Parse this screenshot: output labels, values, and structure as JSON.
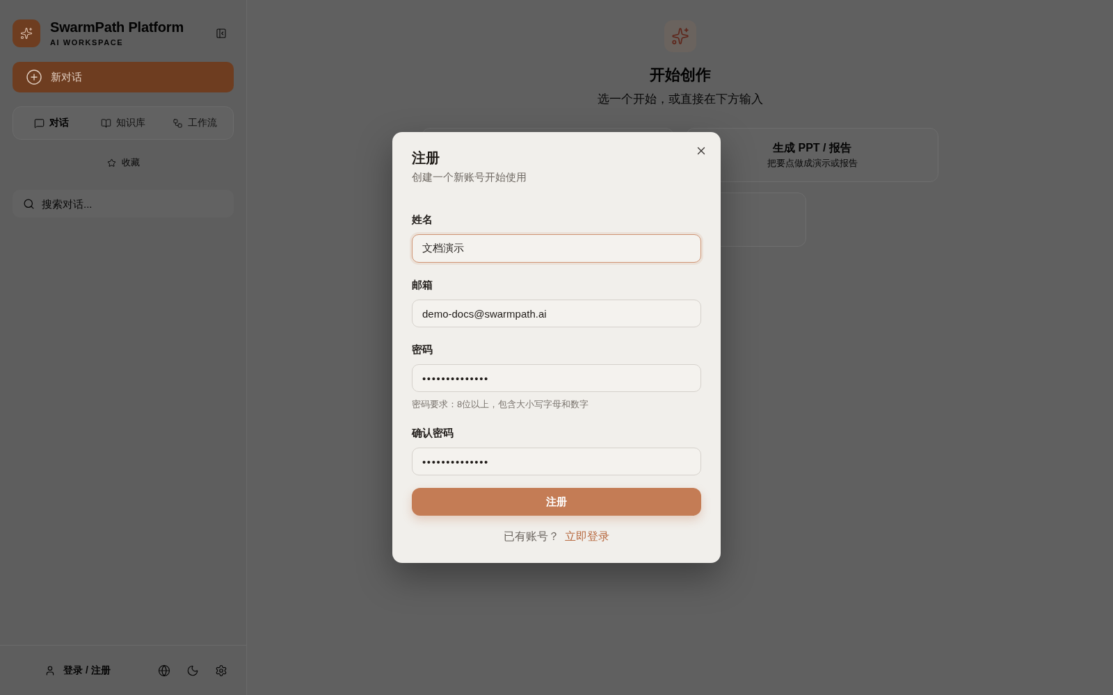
{
  "sidebar": {
    "brand": {
      "name": "SwarmPath Platform",
      "tagline": "AI WORKSPACE"
    },
    "new_chat_button": "新对话",
    "tabs": [
      {
        "label": "对话",
        "selected": true
      },
      {
        "label": "知识库",
        "selected": false
      },
      {
        "label": "工作流",
        "selected": false
      }
    ],
    "favorites_link": "收藏",
    "search": {
      "placeholder": "搜索对话..."
    },
    "footer": {
      "account_link": "登录 / 注册"
    }
  },
  "main": {
    "heading": "开始创作",
    "subheading": "选一个开始，或直接在下方输入",
    "cards": [
      {
        "title": "生成 PPT / 报告",
        "subtitle": "把要点做成演示或报告"
      }
    ]
  },
  "dialog": {
    "title": "注册",
    "subtitle": "创建一个新账号开始使用",
    "fields": [
      {
        "label": "姓名",
        "kind": "text",
        "value": "文档演示",
        "focused": true
      },
      {
        "label": "邮箱",
        "kind": "text",
        "value": "demo-docs@swarmpath.ai",
        "focused": false
      },
      {
        "label": "密码",
        "kind": "password",
        "value": "••••••••••••••",
        "hint": "密码要求：8位以上，包含大小写字母和数字",
        "focused": false
      },
      {
        "label": "确认密码",
        "kind": "password",
        "value": "••••••••••••••",
        "focused": false
      }
    ],
    "submit_button": "注册",
    "footer": {
      "prompt": "已有账号？",
      "link": "立即登录"
    }
  }
}
